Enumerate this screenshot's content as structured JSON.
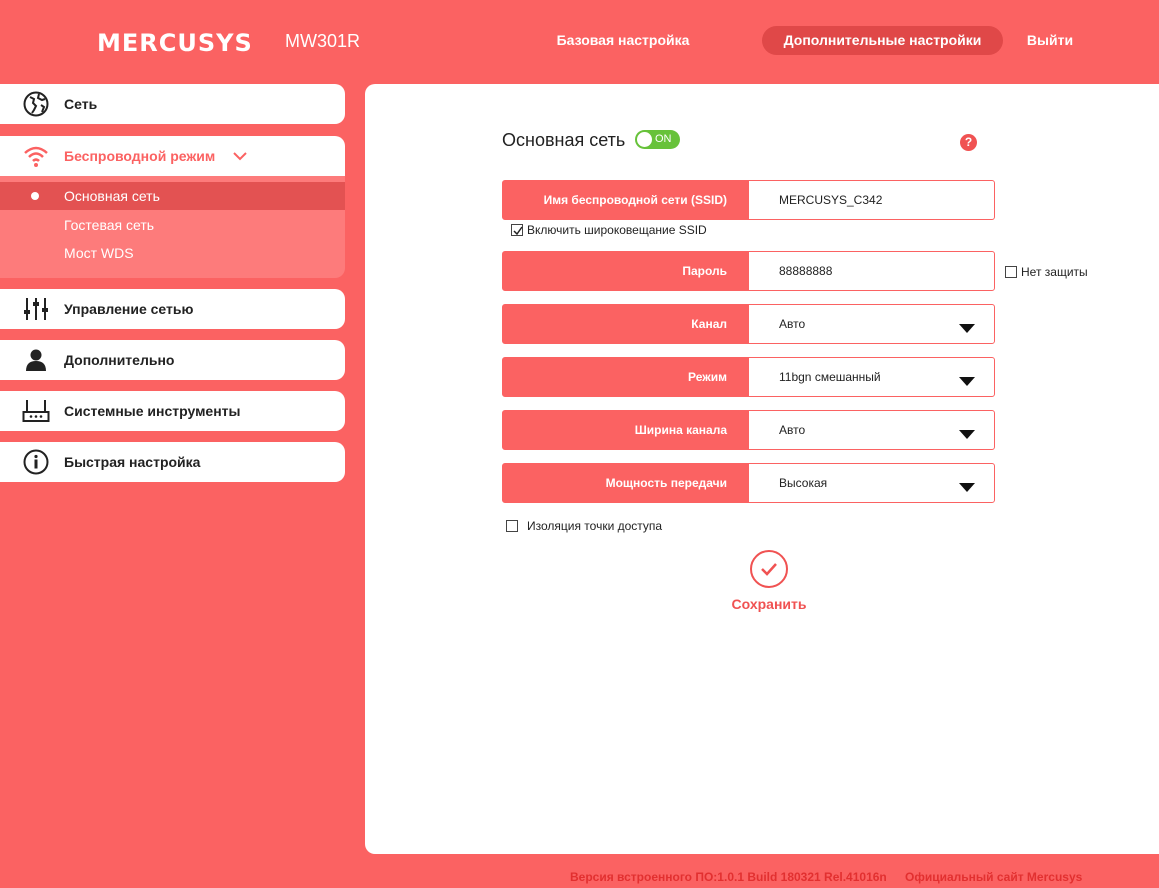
{
  "header": {
    "logo": "MERCUSYS",
    "model": "MW301R",
    "nav": {
      "basic": "Базовая настройка",
      "advanced": "Дополнительные настройки",
      "logout": "Выйти"
    }
  },
  "sidebar": {
    "items": [
      {
        "label": "Сеть",
        "icon": "globe-icon"
      },
      {
        "label": "Беспроводной режим",
        "icon": "wifi-icon"
      },
      {
        "label": "Управление сетью",
        "icon": "sliders-icon"
      },
      {
        "label": "Дополнительно",
        "icon": "user-icon"
      },
      {
        "label": "Системные инструменты",
        "icon": "router-icon"
      },
      {
        "label": "Быстрая настройка",
        "icon": "info-icon"
      }
    ],
    "submenu": [
      {
        "label": "Основная сеть",
        "active": true
      },
      {
        "label": "Гостевая сеть"
      },
      {
        "label": "Мост WDS"
      }
    ]
  },
  "main": {
    "title": "Основная сеть",
    "toggle": "ON",
    "help": "?",
    "ssid": {
      "label": "Имя беспроводной сети (SSID)",
      "value": "MERCUSYS_C342"
    },
    "broadcast": {
      "label": "Включить широковещание SSID",
      "checked": true
    },
    "password": {
      "label": "Пароль",
      "value": "88888888"
    },
    "no_security": {
      "label": "Нет защиты",
      "checked": false
    },
    "channel": {
      "label": "Канал",
      "value": "Авто"
    },
    "mode": {
      "label": "Режим",
      "value": "11bgn смешанный"
    },
    "width": {
      "label": "Ширина канала",
      "value": "Авто"
    },
    "power": {
      "label": "Мощность передачи",
      "value": "Высокая"
    },
    "isolation": {
      "label": "Изоляция точки доступа",
      "checked": false
    },
    "save": "Сохранить"
  },
  "footer": {
    "firmware": "Версия встроенного ПО:1.0.1 Build 180321 Rel.41016n",
    "site": "Официальный сайт Mercusys"
  },
  "colors": {
    "accent": "#fb6262",
    "toggle": "#67c23a",
    "active_nav": "#e04848"
  }
}
